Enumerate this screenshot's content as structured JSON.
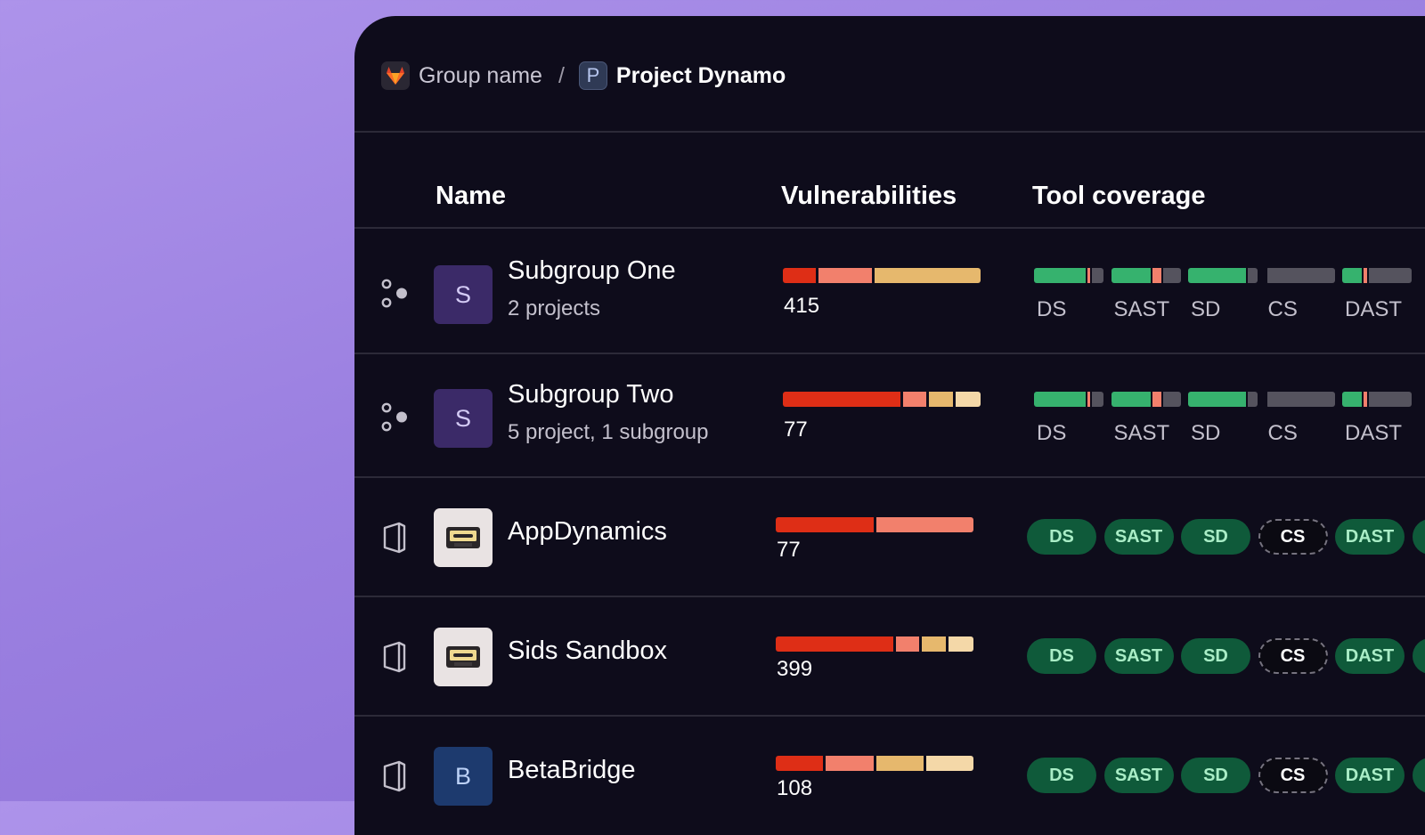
{
  "breadcrumb": {
    "group": "Group name",
    "separator": "/",
    "project_initial": "P",
    "project": "Project Dynamo"
  },
  "columns": {
    "name": "Name",
    "vulnerabilities": "Vulnerabilities",
    "coverage": "Tool coverage"
  },
  "colors": {
    "critical": "#de2e16",
    "high": "#f2806c",
    "medium": "#e6b86d",
    "low": "#f4d8a8",
    "covered": "#36b26e",
    "failed": "#f2806c",
    "none": "#55535e",
    "pill_bg": "#0f5a3a",
    "pill_text": "#a9edc6"
  },
  "rows": [
    {
      "type": "subgroup",
      "icon": "subgroup-icon",
      "avatar": "S",
      "name": "Subgroup One",
      "subtitle": "2 projects",
      "count": "415",
      "severity_ratio": {
        "critical": 0.17,
        "high": 0.28,
        "medium": 0.55,
        "low": 0
      },
      "tools": [
        {
          "label": "DS",
          "covered": 0.78,
          "failed": 0.05
        },
        {
          "label": "SAST",
          "covered": 0.6,
          "failed": 0.13
        },
        {
          "label": "SD",
          "covered": 0.86,
          "failed": 0
        },
        {
          "label": "CS",
          "covered": 0,
          "failed": 0
        },
        {
          "label": "DAST",
          "covered": 0.3,
          "failed": 0.05
        }
      ]
    },
    {
      "type": "subgroup",
      "icon": "subgroup-icon",
      "avatar": "S",
      "name": "Subgroup Two",
      "subtitle": "5 project, 1 subgroup",
      "count": "77",
      "severity_ratio": {
        "critical": 0.62,
        "high": 0.12,
        "medium": 0.13,
        "low": 0.13
      },
      "tools": [
        {
          "label": "DS",
          "covered": 0.78,
          "failed": 0.05
        },
        {
          "label": "SAST",
          "covered": 0.6,
          "failed": 0.13
        },
        {
          "label": "SD",
          "covered": 0.86,
          "failed": 0
        },
        {
          "label": "CS",
          "covered": 0,
          "failed": 0
        },
        {
          "label": "DAST",
          "covered": 0.3,
          "failed": 0.05
        }
      ]
    },
    {
      "type": "project",
      "icon": "project-icon",
      "avatar": "cassette",
      "name": "AppDynamics",
      "subtitle": "",
      "count": "77",
      "severity_ratio": {
        "critical": 0.5,
        "high": 0.5,
        "medium": 0,
        "low": 0
      },
      "pills": [
        {
          "label": "DS",
          "enabled": true
        },
        {
          "label": "SAST",
          "enabled": true
        },
        {
          "label": "SD",
          "enabled": true
        },
        {
          "label": "CS",
          "enabled": false
        },
        {
          "label": "DAST",
          "enabled": true
        }
      ]
    },
    {
      "type": "project",
      "icon": "project-icon",
      "avatar": "cassette",
      "name": "Sids Sandbox",
      "subtitle": "",
      "count": "399",
      "severity_ratio": {
        "critical": 0.62,
        "high": 0.12,
        "medium": 0.13,
        "low": 0.13
      },
      "pills": [
        {
          "label": "DS",
          "enabled": true
        },
        {
          "label": "SAST",
          "enabled": true
        },
        {
          "label": "SD",
          "enabled": true
        },
        {
          "label": "CS",
          "enabled": false
        },
        {
          "label": "DAST",
          "enabled": true
        }
      ]
    },
    {
      "type": "project",
      "icon": "project-icon",
      "avatar": "B",
      "name": "BetaBridge",
      "subtitle": "",
      "count": "108",
      "severity_ratio": {
        "critical": 0.25,
        "high": 0.25,
        "medium": 0.25,
        "low": 0.25
      },
      "pills": [
        {
          "label": "DS",
          "enabled": true
        },
        {
          "label": "SAST",
          "enabled": true
        },
        {
          "label": "SD",
          "enabled": true
        },
        {
          "label": "CS",
          "enabled": false
        },
        {
          "label": "DAST",
          "enabled": true
        }
      ]
    }
  ]
}
